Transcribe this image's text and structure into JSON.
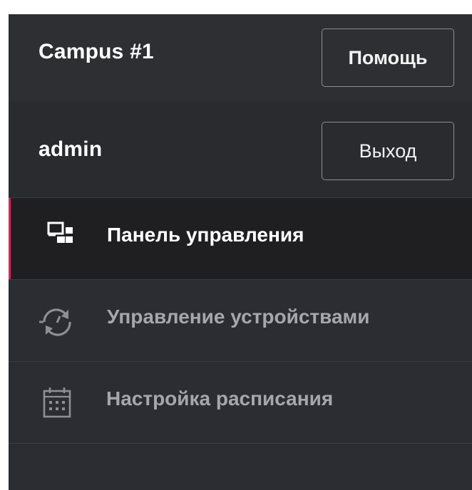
{
  "site": {
    "name": "Campus #1",
    "help_label": "Помощь"
  },
  "user": {
    "name": "admin",
    "logout_label": "Выход"
  },
  "nav": {
    "items": [
      {
        "label": "Панель управления",
        "icon": "dashboard-icon",
        "active": true
      },
      {
        "label": "Управление устройствами",
        "icon": "device-sync-icon",
        "active": false
      },
      {
        "label": "Настройка расписания",
        "icon": "calendar-icon",
        "active": false
      }
    ]
  },
  "colors": {
    "panel_bg": "#2c2d32",
    "active_bg": "#1f1f22",
    "active_accent": "#e0245e",
    "text_primary": "#ffffff",
    "text_muted": "#a6a7ab"
  }
}
